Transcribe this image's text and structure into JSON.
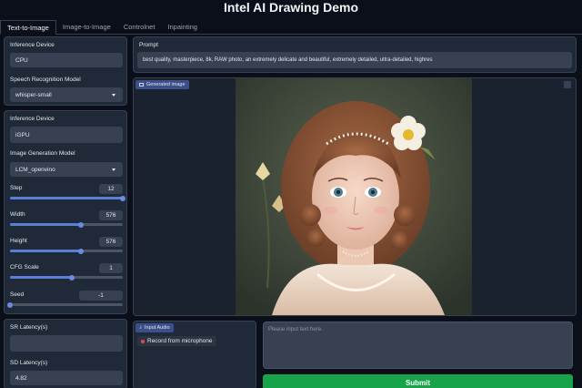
{
  "header": {
    "title": "Intel AI Drawing Demo"
  },
  "tabs": [
    {
      "label": "Text-to-Image"
    },
    {
      "label": "Image-to-Image"
    },
    {
      "label": "Controlnet"
    },
    {
      "label": "Inpainting"
    }
  ],
  "speech_panel": {
    "device_label": "Inference Device",
    "device_value": "CPU",
    "model_label": "Speech Recognition Model",
    "model_value": "whisper-small"
  },
  "image_panel": {
    "device_label": "Inference Device",
    "device_value": "iGPU",
    "model_label": "Image Generation Model",
    "model_value": "LCM_openvino",
    "step": {
      "label": "Step",
      "value": "12",
      "fraction": 1.0
    },
    "width": {
      "label": "Width",
      "value": "576",
      "fraction": 0.625
    },
    "height": {
      "label": "Height",
      "value": "576",
      "fraction": 0.625
    },
    "cfg": {
      "label": "CFG Scale",
      "value": "1",
      "fraction": 0.55
    },
    "seed": {
      "label": "Seed",
      "value": "-1",
      "fraction": 0.0
    }
  },
  "latency_panel": {
    "sr_label": "SR Latency(s)",
    "sr_value": "",
    "sd_label": "SD Latency(s)",
    "sd_value": "4.82"
  },
  "prompt": {
    "label": "Prompt",
    "value": "best quality, masterpiece, 8k, RAW photo, an extremely delicate and beautiful, extremely detailed, ultra-detailed, highres"
  },
  "output": {
    "badge": "Generated image"
  },
  "audio": {
    "badge": "Input Audio",
    "record_label": "Record from microphone"
  },
  "text_input": {
    "placeholder": "Please input text here."
  },
  "submit": {
    "label": "Submit"
  },
  "colors": {
    "accent": "#16a34a",
    "slider": "#5b7fd6",
    "panel": "#1f2937",
    "background": "#0b0f19"
  }
}
